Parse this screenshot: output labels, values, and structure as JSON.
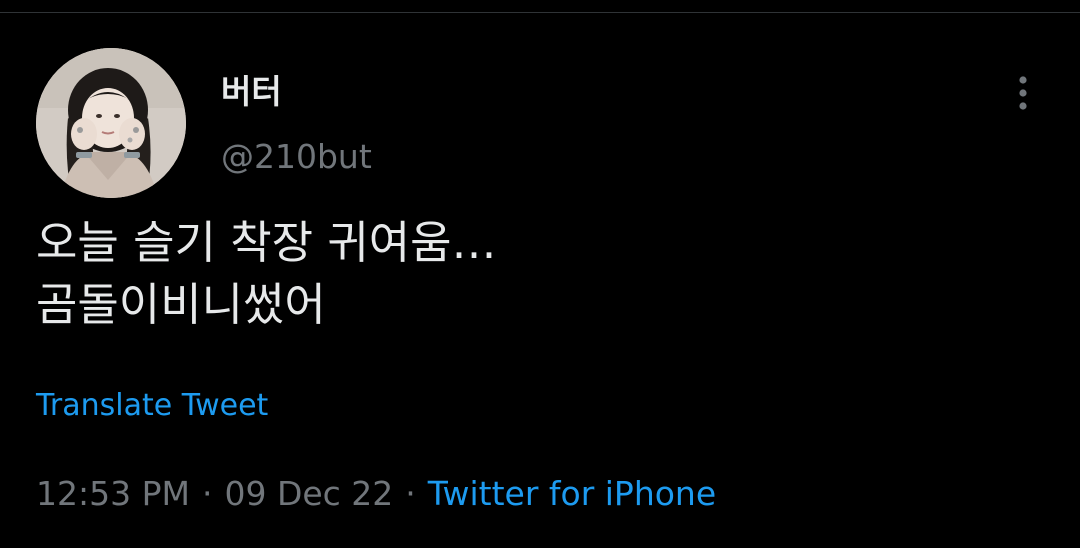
{
  "tweet": {
    "author": {
      "display_name": "버터",
      "handle": "@210but"
    },
    "text_lines": [
      "오늘 슬기 착장 귀여움…",
      "곰돌이비니썼어"
    ],
    "translate_label": "Translate Tweet",
    "time": "12:53 PM",
    "date": "09 Dec 22",
    "separator": "·",
    "source": "Twitter for iPhone"
  },
  "icons": {
    "more": "more-vertical-icon",
    "avatar": "profile-photo"
  },
  "colors": {
    "background": "#000000",
    "text_primary": "#e7e9ea",
    "text_secondary": "#71767b",
    "accent": "#1d9bf0",
    "divider": "#2f3336"
  }
}
